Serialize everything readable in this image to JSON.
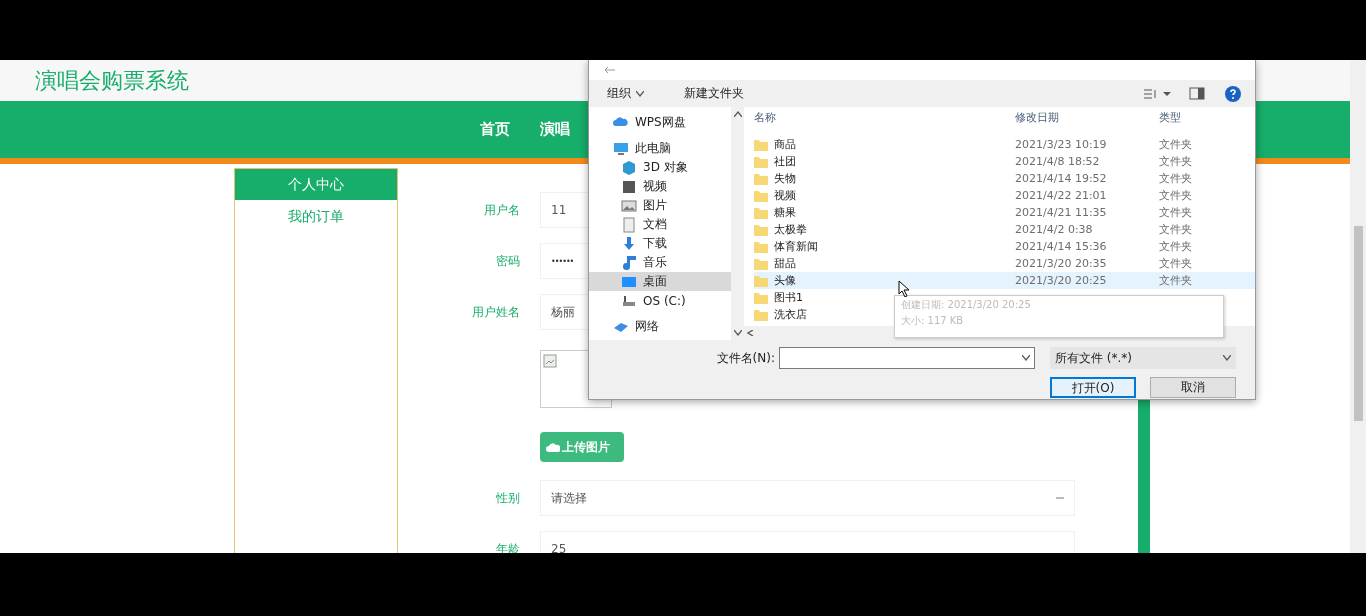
{
  "site": {
    "title": "演唱会购票系统",
    "nav": [
      {
        "label": "首页",
        "selected": false
      },
      {
        "label": "演唱",
        "selected": false
      }
    ]
  },
  "sidebar": {
    "title": "个人中心",
    "items": [
      {
        "label": "我的订单",
        "selected": false
      }
    ]
  },
  "form": {
    "fields": [
      {
        "kind": "text",
        "label": "用户名",
        "value": "11"
      },
      {
        "kind": "password",
        "label": "密码",
        "value": "••••••"
      },
      {
        "kind": "text",
        "label": "用户姓名",
        "value": "杨丽"
      },
      {
        "kind": "image"
      },
      {
        "kind": "upload",
        "label": "上传图片"
      },
      {
        "kind": "select",
        "label": "性别",
        "value": "请选择"
      },
      {
        "kind": "text",
        "label": "年龄",
        "value": "25"
      }
    ]
  },
  "dialog": {
    "toolbar": {
      "organize": "组织",
      "new_folder": "新建文件夹"
    },
    "nav_tree": [
      {
        "label": "WPS网盘",
        "selected": false
      },
      {
        "label": "此电脑",
        "selected": false,
        "children": [
          {
            "label": "3D 对象",
            "selected": false
          },
          {
            "label": "视频",
            "selected": false
          },
          {
            "label": "图片",
            "selected": false
          },
          {
            "label": "文档",
            "selected": false
          },
          {
            "label": "下载",
            "selected": false
          },
          {
            "label": "音乐",
            "selected": false
          },
          {
            "label": "桌面",
            "selected": true
          },
          {
            "label": "OS (C:)",
            "selected": false
          }
        ]
      },
      {
        "label": "网络",
        "selected": false
      }
    ],
    "columns": [
      "名称",
      "修改日期",
      "类型"
    ],
    "rows": [
      {
        "name": "商品",
        "date": "2021/3/23 10:19",
        "type": "文件夹",
        "hovered": false
      },
      {
        "name": "社团",
        "date": "2021/4/8 18:52",
        "type": "文件夹",
        "hovered": false
      },
      {
        "name": "失物",
        "date": "2021/4/14 19:52",
        "type": "文件夹",
        "hovered": false
      },
      {
        "name": "视频",
        "date": "2021/4/22 21:01",
        "type": "文件夹",
        "hovered": false
      },
      {
        "name": "糖果",
        "date": "2021/4/21 11:35",
        "type": "文件夹",
        "hovered": false
      },
      {
        "name": "太极拳",
        "date": "2021/4/2 0:38",
        "type": "文件夹",
        "hovered": false
      },
      {
        "name": "体育新闻",
        "date": "2021/4/14 15:36",
        "type": "文件夹",
        "hovered": false
      },
      {
        "name": "甜品",
        "date": "2021/3/20 20:35",
        "type": "文件夹",
        "hovered": false
      },
      {
        "name": "头像",
        "date": "2021/3/20 20:25",
        "type": "文件夹",
        "hovered": true
      },
      {
        "name": "图书1",
        "hovered": false
      },
      {
        "name": "洗衣店",
        "hovered": false
      }
    ],
    "tooltip": [
      "创建日期: 2021/3/20 20:25",
      "大小: 117 KB"
    ],
    "filename_label": "文件名(N):",
    "filter": "所有文件 (*.*)",
    "buttons": [
      {
        "label": "打开(O)",
        "kind": "primary"
      },
      {
        "label": "取消",
        "kind": "secondary"
      }
    ]
  }
}
